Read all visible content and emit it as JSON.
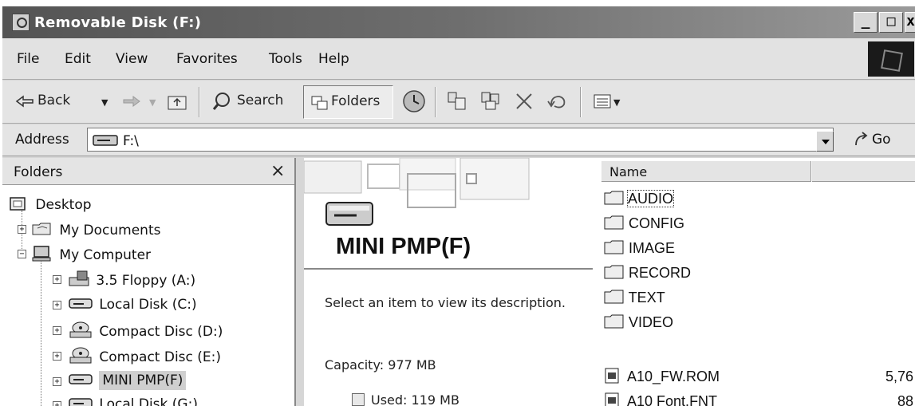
{
  "window": {
    "title": "Removable Disk (F:)"
  },
  "winbtns": {
    "minimize": "_",
    "maximize": "□",
    "close": "x"
  },
  "menu": {
    "file": "File",
    "edit": "Edit",
    "view": "View",
    "favorites": "Favorites",
    "tools": "Tools",
    "help": "Help"
  },
  "toolbar": {
    "back": "Back",
    "search": "Search",
    "folders": "Folders"
  },
  "address": {
    "label": "Address",
    "value": "F:\\",
    "go": "Go"
  },
  "folders_pane": {
    "title": "Folders",
    "close": "×",
    "items": [
      {
        "label": "Desktop"
      },
      {
        "label": "My Documents"
      },
      {
        "label": "My Computer"
      },
      {
        "label": "3.5 Floppy (A:)"
      },
      {
        "label": "Local Disk (C:)"
      },
      {
        "label": "Compact Disc (D:)"
      },
      {
        "label": "Compact Disc (E:)"
      },
      {
        "label": "MINI PMP(F)"
      },
      {
        "label": "Local Disk (G:)"
      }
    ]
  },
  "info": {
    "drive_name": "MINI PMP(F)",
    "description": "Select an item to view its description.",
    "capacity": "Capacity: 977 MB",
    "used": "Used: 119 MB"
  },
  "list": {
    "column_name": "Name",
    "folders": [
      "AUDIO",
      "CONFIG",
      "IMAGE",
      "RECORD",
      "TEXT",
      "VIDEO"
    ],
    "files": [
      {
        "name": "A10_FW.ROM",
        "size": "5,76"
      },
      {
        "name": "A10 Font.FNT",
        "size": "88"
      }
    ]
  }
}
